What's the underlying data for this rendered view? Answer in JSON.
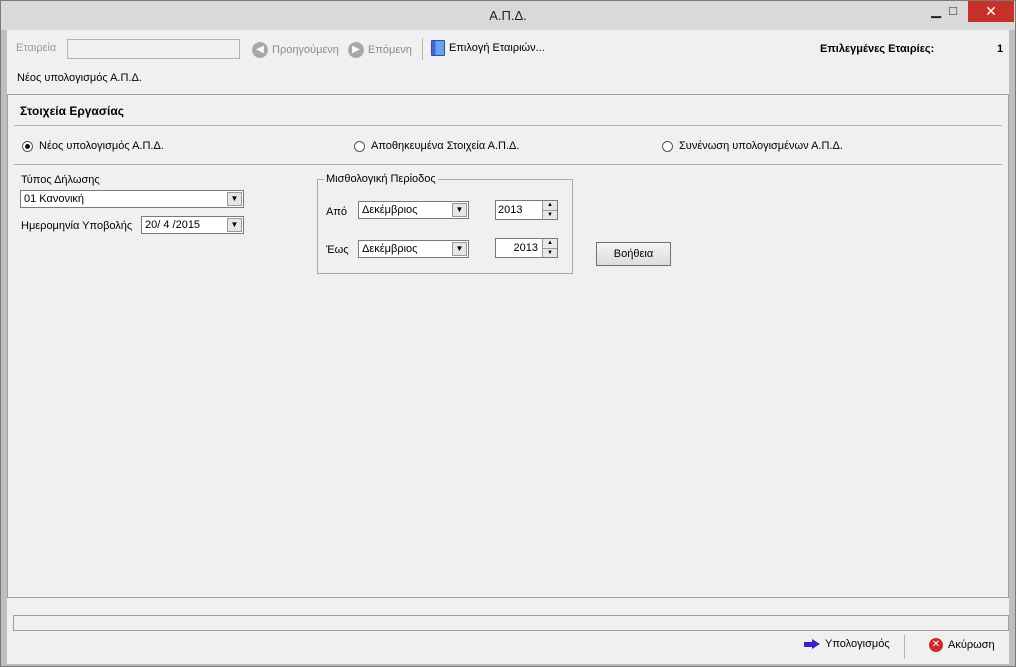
{
  "window": {
    "title": "Α.Π.Δ.",
    "minimize_glyph": "▁",
    "maximize_glyph": "□",
    "close_glyph": "✕"
  },
  "toolbar": {
    "company_label": "Εταιρεία",
    "company_value": "",
    "prev_label": "Προηγούμενη",
    "next_label": "Επόμενη",
    "select_companies_label": "Επιλογή Εταιριών...",
    "selected_companies_label": "Επιλεγμένες Εταιρίες:",
    "selected_companies_count": "1",
    "subtitle": "Νέος υπολογισμός Α.Π.Δ."
  },
  "main": {
    "section_title": "Στοιχεία Εργασίας",
    "radios": [
      {
        "label": "Νέος υπολογισμός Α.Π.Δ.",
        "selected": true
      },
      {
        "label": "Αποθηκευμένα Στοιχεία Α.Π.Δ.",
        "selected": false
      },
      {
        "label": "Συνένωση υπολογισμένων Α.Π.Δ.",
        "selected": false
      }
    ],
    "declaration_type_label": "Τύπος Δήλωσης",
    "declaration_type_value": "01 Κανονική",
    "submission_date_label": "Ημερομηνία Υποβολής",
    "submission_date_value": "20/ 4 /2015",
    "period": {
      "title": "Μισθολογική Περίοδος",
      "from_label": "Από",
      "from_month": "Δεκέμβριος",
      "from_year": "2013",
      "to_label": "Έως",
      "to_month": "Δεκέμβριος",
      "to_year": "2013"
    },
    "help_label": "Βοήθεια"
  },
  "footer": {
    "calculate_label": "Υπολογισμός",
    "cancel_label": "Ακύρωση",
    "status_text": ""
  },
  "colors": {
    "accent_arrow": "#3a22c9",
    "cancel_red": "#c92a2a",
    "close_red": "#c7312a"
  }
}
